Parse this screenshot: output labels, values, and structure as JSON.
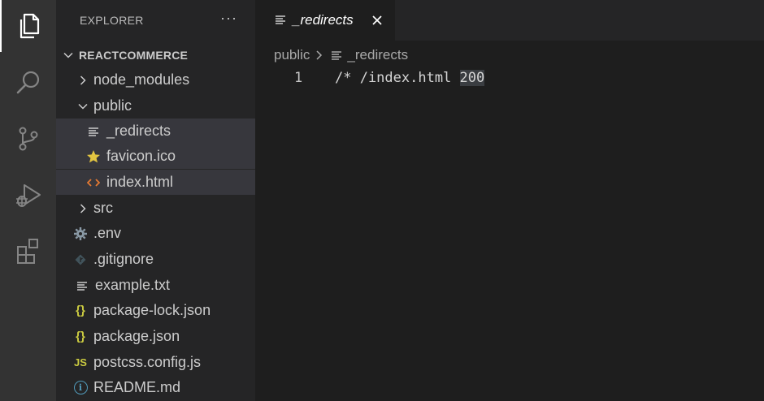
{
  "activity_bar": {
    "items": [
      {
        "icon": "files-icon",
        "active": true
      },
      {
        "icon": "search-icon",
        "active": false
      },
      {
        "icon": "source-control-icon",
        "active": false
      },
      {
        "icon": "run-debug-icon",
        "active": false
      },
      {
        "icon": "extensions-icon",
        "active": false
      }
    ]
  },
  "explorer": {
    "title": "EXPLORER",
    "more": "···",
    "root": "REACTCOMMERCE",
    "tree": [
      {
        "label": "node_modules",
        "type": "folder",
        "expanded": false
      },
      {
        "label": "public",
        "type": "folder",
        "expanded": true
      },
      {
        "label": "_redirects",
        "type": "file",
        "icon": "lines-icon"
      },
      {
        "label": "favicon.ico",
        "type": "file",
        "icon": "star-icon"
      },
      {
        "label": "index.html",
        "type": "file",
        "icon": "html-icon"
      },
      {
        "label": "src",
        "type": "folder",
        "expanded": false
      },
      {
        "label": ".env",
        "type": "file",
        "icon": "gear-icon"
      },
      {
        "label": ".gitignore",
        "type": "file",
        "icon": "git-icon"
      },
      {
        "label": "example.txt",
        "type": "file",
        "icon": "lines-icon"
      },
      {
        "label": "package-lock.json",
        "type": "file",
        "icon": "json-icon",
        "glyph": "{}"
      },
      {
        "label": "package.json",
        "type": "file",
        "icon": "json-icon",
        "glyph": "{}"
      },
      {
        "label": "postcss.config.js",
        "type": "file",
        "icon": "js-icon",
        "glyph": "JS"
      },
      {
        "label": "README.md",
        "type": "file",
        "icon": "info-icon",
        "glyph": "i"
      }
    ]
  },
  "editor": {
    "tab": {
      "label": "_redirects",
      "icon": "lines-icon",
      "close_icon": "close-icon"
    },
    "breadcrumb": {
      "folder": "public",
      "file": "_redirects"
    },
    "lines": [
      {
        "number": "1",
        "text_before": "/* /index.html ",
        "text_highlight": "200"
      }
    ]
  },
  "colors": {
    "activity_bar": "#333333",
    "sidebar": "#252526",
    "editor": "#1e1e1e",
    "selected_row": "#37373d",
    "star": "#e2c541",
    "html": "#e37933",
    "json": "#cbcb41",
    "info": "#519aba"
  }
}
